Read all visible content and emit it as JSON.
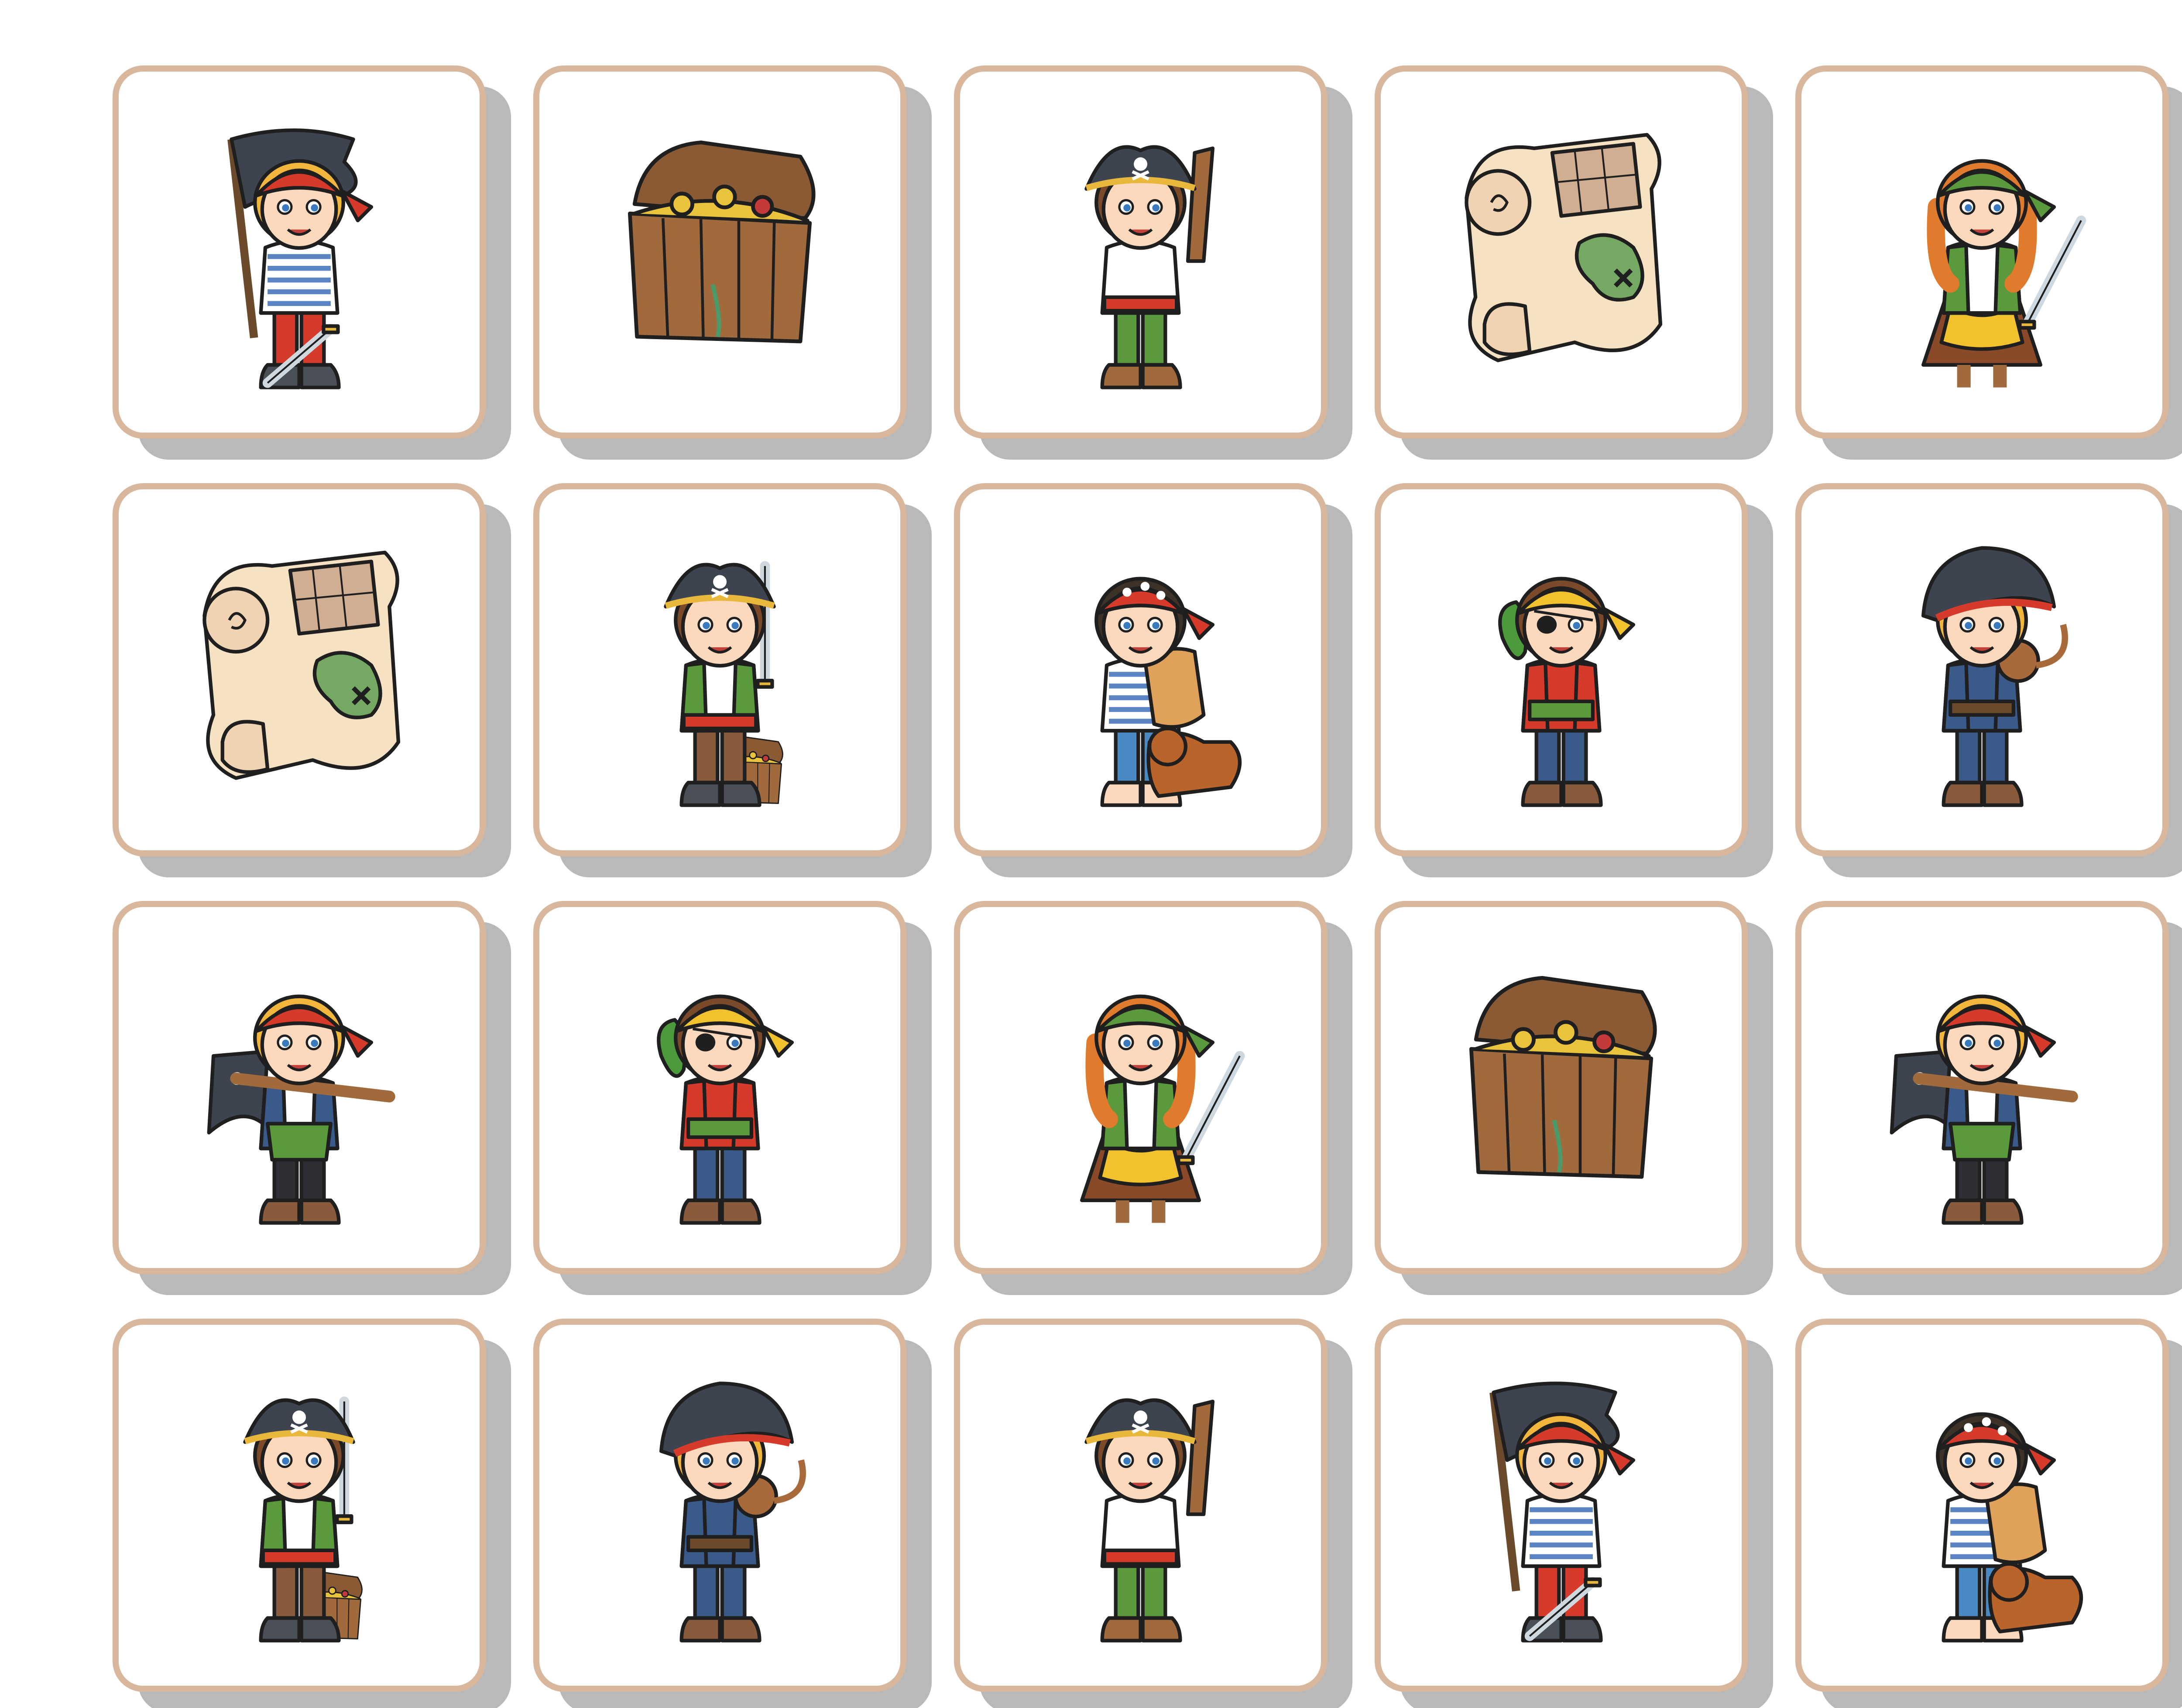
{
  "board": {
    "rows": 4,
    "columns": 5,
    "cards": [
      {
        "picture": "flag-pirate-boy-icon"
      },
      {
        "picture": "treasure-chest-icon"
      },
      {
        "picture": "tricorn-pirate-with-wooden-sword-icon"
      },
      {
        "picture": "treasure-map-icon"
      },
      {
        "picture": "pirate-girl-with-sabre-icon"
      },
      {
        "picture": "treasure-map-icon"
      },
      {
        "picture": "tricorn-pirate-on-chest-icon"
      },
      {
        "picture": "pirate-with-scroll-and-dog-icon"
      },
      {
        "picture": "eyepatch-pirate-with-parrot-icon"
      },
      {
        "picture": "captain-with-monkey-icon"
      },
      {
        "picture": "bandana-pirate-with-spyglass-icon"
      },
      {
        "picture": "eyepatch-pirate-with-parrot-icon"
      },
      {
        "picture": "pirate-girl-with-sabre-icon"
      },
      {
        "picture": "treasure-chest-icon"
      },
      {
        "picture": "bandana-pirate-with-spyglass-icon"
      },
      {
        "picture": "tricorn-pirate-on-chest-icon"
      },
      {
        "picture": "captain-with-monkey-icon"
      },
      {
        "picture": "tricorn-pirate-with-wooden-sword-icon"
      },
      {
        "picture": "flag-pirate-boy-icon"
      },
      {
        "picture": "pirate-with-scroll-and-dog-icon"
      }
    ]
  },
  "colors": {
    "card_border": "#d9b79c",
    "card_shadow": "#b9b9b9",
    "hat": "#3d4450",
    "gold_trim": "#e8b73b",
    "red_bandana": "#d63a2a",
    "yellow_bandana": "#f2c12e",
    "green_bandana": "#5a9a3c",
    "skin": "#fcd9bd",
    "blond_hair": "#f2b63c",
    "ginger_hair": "#e07a2c",
    "wood": "#a06a3c",
    "parchment": "#f6e2c2",
    "map_green": "#74a863"
  }
}
